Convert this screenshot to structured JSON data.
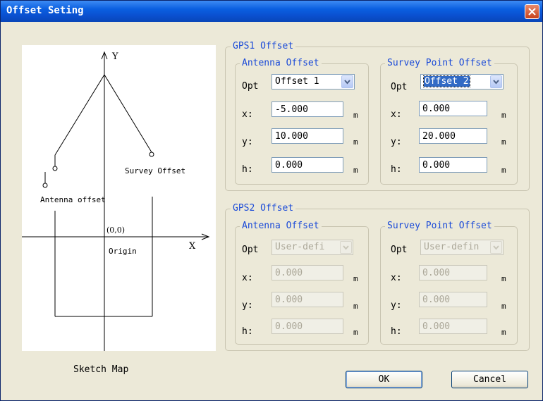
{
  "window": {
    "title": "Offset Seting"
  },
  "sketch": {
    "caption": "Sketch Map",
    "axis_y": "Y",
    "axis_x": "X",
    "origin_coords": "(0,0)",
    "origin_label": "Origin",
    "antenna_label": "Antenna offset",
    "survey_label": "Survey Offset"
  },
  "labels": {
    "opt": "Opt",
    "x": "x:",
    "y": "y:",
    "h": "h:",
    "unit": "m"
  },
  "gps1": {
    "title": "GPS1 Offset",
    "antenna": {
      "title": "Antenna Offset",
      "opt": "Offset 1",
      "x": "-5.000",
      "y": "10.000",
      "h": "0.000"
    },
    "survey": {
      "title": "Survey Point Offset",
      "opt": "Offset 2",
      "x": "0.000",
      "y": "20.000",
      "h": "0.000"
    }
  },
  "gps2": {
    "title": "GPS2 Offset",
    "antenna": {
      "title": "Antenna Offset",
      "opt": "User-defi",
      "x": "0.000",
      "y": "0.000",
      "h": "0.000"
    },
    "survey": {
      "title": "Survey Point Offset",
      "opt": "User-defin",
      "x": "0.000",
      "y": "0.000",
      "h": "0.000"
    }
  },
  "buttons": {
    "ok": "OK",
    "cancel": "Cancel"
  }
}
